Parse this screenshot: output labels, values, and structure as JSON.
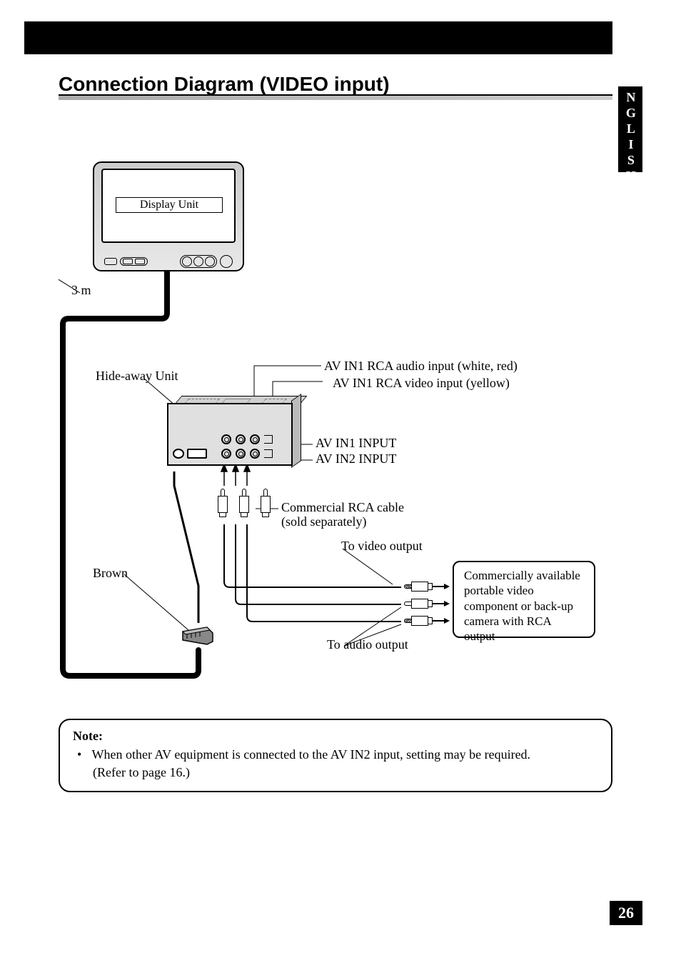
{
  "header": {
    "section_title": "Connection Diagram (VIDEO input)"
  },
  "language_tab": "ENGLISH",
  "page_number": "26",
  "diagram": {
    "display_unit_label": "Display Unit",
    "cable_length": "3 m",
    "hideaway_label": "Hide-away Unit",
    "av_in1_audio": "AV IN1 RCA audio input (white, red)",
    "av_in1_video": "AV IN1 RCA video input (yellow)",
    "av_in1_input": "AV IN1 INPUT",
    "av_in2_input": "AV IN2 INPUT",
    "rca_cable_line1": "Commercial RCA cable",
    "rca_cable_line2": "(sold separately)",
    "to_video_output": "To video output",
    "to_audio_output": "To audio output",
    "brown_label": "Brown",
    "device_box": "Commercially available portable video component or back-up camera with RCA output"
  },
  "note": {
    "title": "Note:",
    "bullet": "When other AV equipment is connected to the AV IN2 input, setting may be required.",
    "sub": "(Refer to page 16.)"
  }
}
